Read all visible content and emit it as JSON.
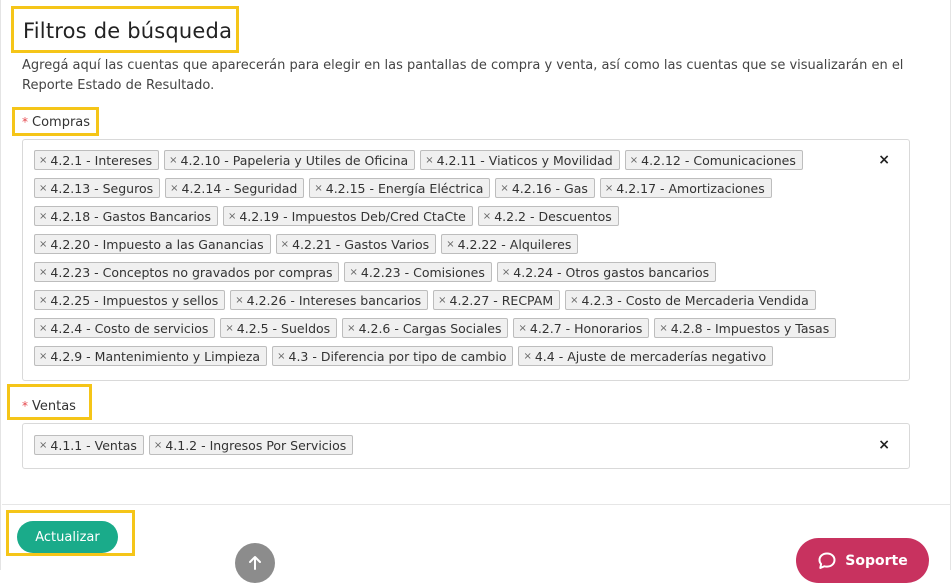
{
  "title": "Filtros de búsqueda",
  "description": "Agregá aquí las cuentas que aparecerán para elegir en las pantallas de compra y venta, así como las cuentas que se visualizarán en el Reporte Estado de Resultado.",
  "compras": {
    "required_mark": "*",
    "label": "Compras",
    "clear_symbol": "×",
    "tags": [
      "4.2.1 - Intereses",
      "4.2.10 - Papeleria y Utiles de Oficina",
      "4.2.11 - Viaticos y Movilidad",
      "4.2.12 - Comunicaciones",
      "4.2.13 - Seguros",
      "4.2.14 - Seguridad",
      "4.2.15 - Energía Eléctrica",
      "4.2.16 - Gas",
      "4.2.17 - Amortizaciones",
      "4.2.18 - Gastos Bancarios",
      "4.2.19 - Impuestos Deb/Cred CtaCte",
      "4.2.2 - Descuentos",
      "4.2.20 - Impuesto a las Ganancias",
      "4.2.21 - Gastos Varios",
      "4.2.22 - Alquileres",
      "4.2.23 - Conceptos no gravados por compras",
      "4.2.23 - Comisiones",
      "4.2.24 - Otros gastos bancarios",
      "4.2.25 - Impuestos y sellos",
      "4.2.26 - Intereses bancarios",
      "4.2.27 - RECPAM",
      "4.2.3 - Costo de Mercaderia Vendida",
      "4.2.4 - Costo de servicios",
      "4.2.5 - Sueldos",
      "4.2.6 - Cargas Sociales",
      "4.2.7 - Honorarios",
      "4.2.8 - Impuestos y Tasas",
      "4.2.9 - Mantenimiento y Limpieza",
      "4.3 - Diferencia por tipo de cambio",
      "4.4 - Ajuste de mercaderías negativo"
    ]
  },
  "ventas": {
    "required_mark": "*",
    "label": "Ventas",
    "clear_symbol": "×",
    "tags": [
      "4.1.1 - Ventas",
      "4.1.2 - Ingresos Por Servicios"
    ]
  },
  "tag_remove_symbol": "×",
  "update_button": "Actualizar",
  "support_button": "Soporte",
  "scroll_top_icon": "arrow-up-icon",
  "colors": {
    "accent_green": "#1aab8a",
    "support_pink": "#c8325f",
    "highlight_yellow": "#f5c518",
    "required_red": "#e5484d"
  }
}
